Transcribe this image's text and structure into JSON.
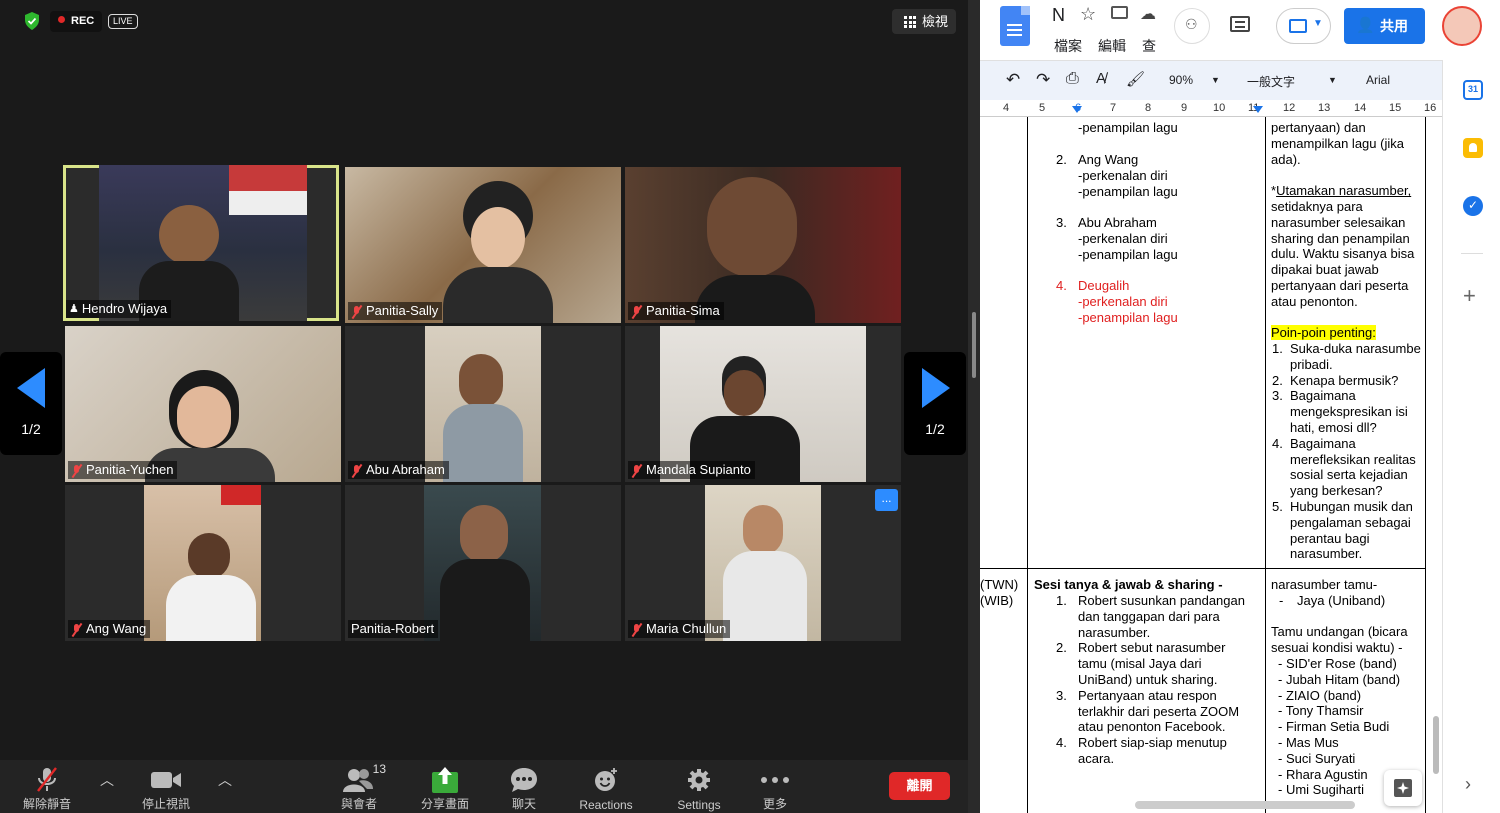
{
  "zoom": {
    "rec_label": "REC",
    "live_label": "LIVE",
    "view_label": "檢視",
    "page_indicator_left": "1/2",
    "page_indicator_right": "1/2",
    "more_label": "...",
    "participants": [
      {
        "name": "Hendro Wijaya",
        "audio": "speaking",
        "active": true
      },
      {
        "name": "Panitia-Sally",
        "audio": "muted"
      },
      {
        "name": "Panitia-Sima",
        "audio": "muted"
      },
      {
        "name": "Panitia-Yuchen",
        "audio": "muted"
      },
      {
        "name": "Abu Abraham",
        "audio": "muted"
      },
      {
        "name": "Mandala Supianto",
        "audio": "muted"
      },
      {
        "name": "Ang Wang",
        "audio": "muted"
      },
      {
        "name": "Panitia-Robert",
        "audio": "on"
      },
      {
        "name": "Maria Chullun",
        "audio": "muted"
      }
    ],
    "toolbar": {
      "unmute_label": "解除靜音",
      "stop_video_label": "停止視訊",
      "participants_label": "與會者",
      "participants_count": "13",
      "share_label": "分享畫面",
      "chat_label": "聊天",
      "reactions_label": "Reactions",
      "settings_label": "Settings",
      "more_label": "更多",
      "leave_label": "離開"
    }
  },
  "docs": {
    "title_initial": "N",
    "menu": [
      "檔案",
      "編輯",
      "查"
    ],
    "share_label": "共用",
    "zoom_value": "90%",
    "style_value": "一般文字",
    "font_value": "Arial",
    "ruler": [
      "4",
      "5",
      "6",
      "7",
      "8",
      "9",
      "10",
      "11",
      "12",
      "13",
      "14",
      "15",
      "16"
    ],
    "col2_top": [
      "-penampilan lagu"
    ],
    "col2_items": [
      {
        "num": "2.",
        "lines": [
          "Ang Wang",
          "-perkenalan diri",
          "-penampilan lagu"
        ],
        "red": false
      },
      {
        "num": "3.",
        "lines": [
          "Abu Abraham",
          "-perkenalan diri",
          "-penampilan lagu"
        ],
        "red": false
      },
      {
        "num": "4.",
        "lines": [
          "Deugalih",
          "-perkenalan diri",
          "-penampilan lagu"
        ],
        "red": true
      }
    ],
    "col3_top": [
      "pertanyaan) dan",
      "menampilkan lagu (jika",
      "ada)."
    ],
    "col3_note_lead": "*",
    "col3_note_underlined": "Utamakan narasumber,",
    "col3_note_rest": [
      "setidaknya para",
      "narasumber selesaikan",
      "sharing dan penampilan",
      "dulu. Waktu sisanya bisa",
      "dipakai buat jawab",
      "pertanyaan dari peserta",
      "atau penonton."
    ],
    "col3_points_title": "Poin-poin penting:",
    "col3_points": [
      {
        "num": "1.",
        "lines": [
          "Suka-duka narasumbe",
          "pribadi."
        ]
      },
      {
        "num": "2.",
        "lines": [
          "Kenapa bermusik?"
        ]
      },
      {
        "num": "3.",
        "lines": [
          "Bagaimana",
          "mengekspresikan isi",
          "hati, emosi dll?"
        ]
      },
      {
        "num": "4.",
        "lines": [
          "Bagaimana",
          "merefleksikan realitas",
          "sosial serta kejadian",
          "yang berkesan?"
        ]
      },
      {
        "num": "5.",
        "lines": [
          "Hubungan musik dan",
          "pengalaman sebagai",
          "perantau bagi",
          "narasumber."
        ]
      }
    ],
    "col1_bottom": [
      "(TWN)",
      "(WIB)"
    ],
    "col2_bottom_title": "Sesi tanya & jawab & sharing -",
    "col2_bottom_items": [
      {
        "num": "1.",
        "lines": [
          "Robert susunkan pandangan",
          "dan tanggapan dari para",
          "narasumber."
        ]
      },
      {
        "num": "2.",
        "lines": [
          "Robert sebut narasumber",
          "tamu (misal Jaya dari",
          "UniBand) untuk sharing."
        ]
      },
      {
        "num": "3.",
        "lines": [
          "Pertanyaan atau respon",
          "terlakhir dari peserta ZOOM",
          "atau penonton Facebook."
        ]
      },
      {
        "num": "4.",
        "lines": [
          "Robert siap-siap menutup",
          "acara."
        ]
      }
    ],
    "col3_bottom_title": "narasumber tamu-",
    "col3_bottom_guest": "Jaya (Uniband)",
    "col3_bottom_invite": [
      "Tamu undangan (bicara",
      "sesuai kondisi waktu) -"
    ],
    "col3_bottom_list": [
      "SID'er Rose (band)",
      "Jubah Hitam (band)",
      "ZIAIO (band)",
      "Tony Thamsir",
      "Firman Setia Budi",
      "Mas Mus",
      "Suci Suryati",
      "Rhara Agustin",
      "Umi Sugiharti"
    ]
  }
}
